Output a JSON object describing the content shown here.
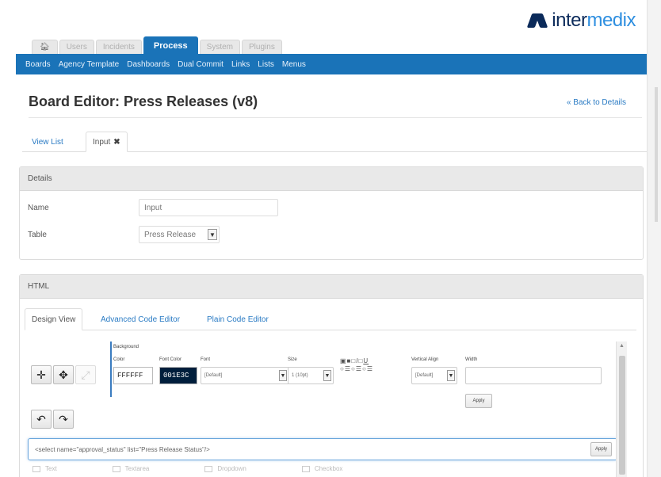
{
  "brand": {
    "logo_text_1": "inter",
    "logo_text_2": "medix"
  },
  "top_tabs": [
    {
      "label": "Users"
    },
    {
      "label": "Incidents"
    },
    {
      "label": "Process"
    },
    {
      "label": "System"
    },
    {
      "label": "Plugins"
    }
  ],
  "nav": [
    "Boards",
    "Agency Template",
    "Dashboards",
    "Dual Commit",
    "Links",
    "Lists",
    "Menus"
  ],
  "page": {
    "title": "Board Editor: Press Releases (v8)",
    "back_link": "« Back to Details"
  },
  "list_tabs": {
    "view_list": "View List",
    "input": "Input"
  },
  "details": {
    "header": "Details",
    "name_label": "Name",
    "name_value": "Input",
    "table_label": "Table",
    "table_value": "Press Release"
  },
  "html_panel": {
    "header": "HTML",
    "tabs": [
      "Design View",
      "Advanced Code Editor",
      "Plain Code Editor"
    ]
  },
  "toolbar": {
    "background_label": "Background",
    "color_label": "Color",
    "color_value": "FFFFFF",
    "font_color_label": "Font Color",
    "font_color_value": "001E3C",
    "font_label": "Font",
    "font_value": "[Default]",
    "size_label": "Size",
    "size_value": "1 (10pt)",
    "valign_label": "Vertical Align",
    "valign_value": "[Default]",
    "width_label": "Width",
    "apply_label": "Apply"
  },
  "code_line": {
    "value": "<select name=\"approval_status\" list=\"Press Release Status\"/>",
    "apply_label": "Apply"
  },
  "bottom_items": [
    "Text",
    "Textarea",
    "Dropdown",
    "Checkbox"
  ],
  "colors": {
    "primary": "#1a73b8",
    "font_color_swatch": "#001E3C",
    "link": "#2a7bc4"
  }
}
